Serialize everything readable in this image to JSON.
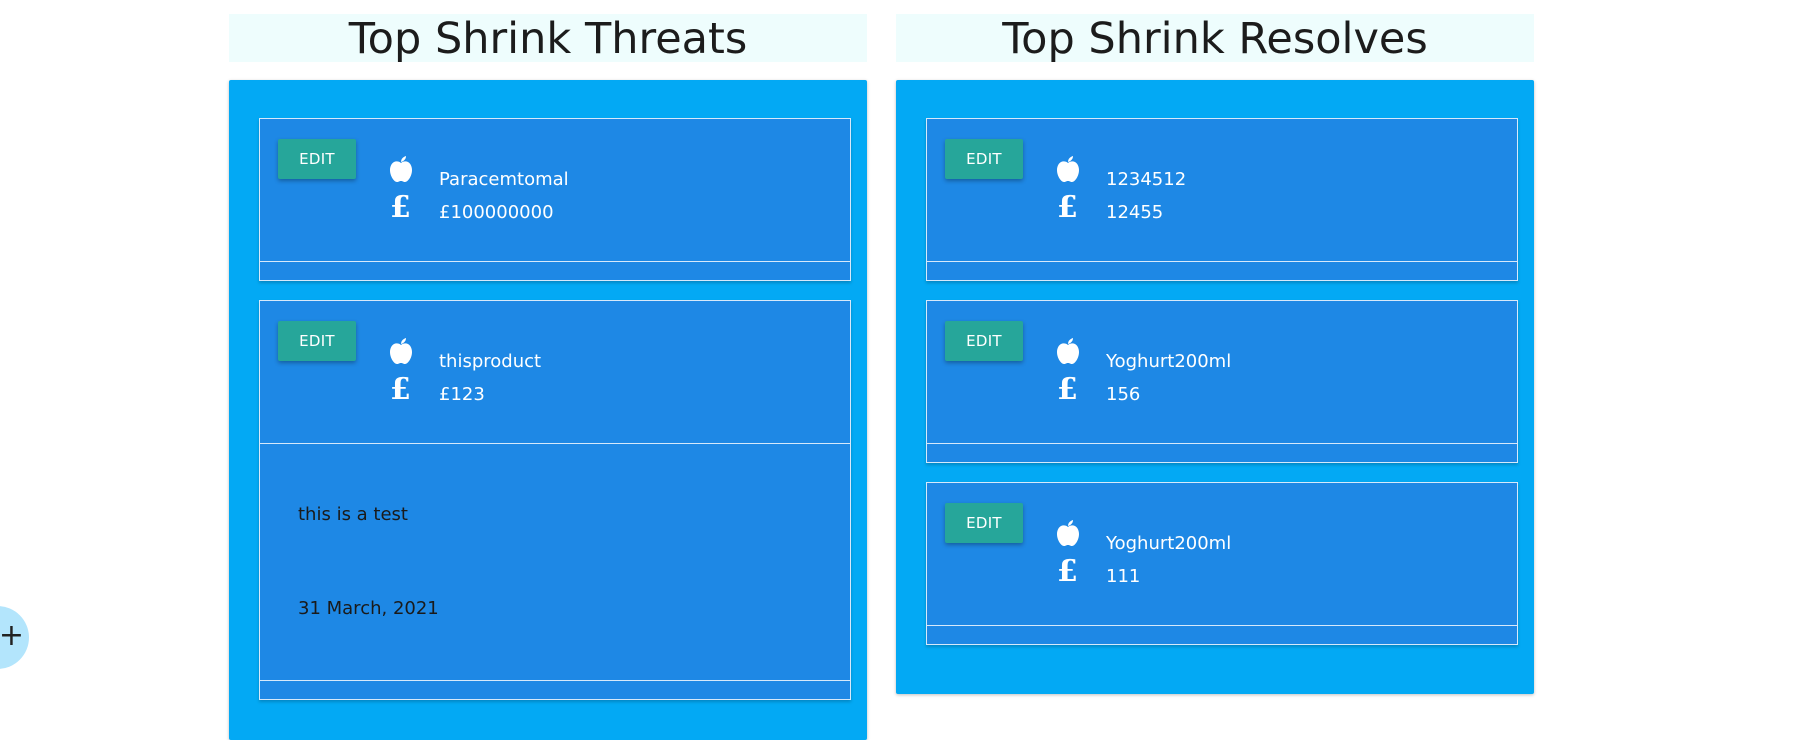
{
  "threats": {
    "title": "Top Shrink Threats",
    "cards": [
      {
        "edit_label": "EDIT",
        "product": "Paracemtomal",
        "value": "£100000000"
      },
      {
        "edit_label": "EDIT",
        "product": "thisproduct",
        "value": "£123",
        "note": "this is a test",
        "date": "31 March, 2021"
      }
    ]
  },
  "resolves": {
    "title": "Top Shrink Resolves",
    "cards": [
      {
        "edit_label": "EDIT",
        "product": "1234512",
        "value": "12455"
      },
      {
        "edit_label": "EDIT",
        "product": "Yoghurt200ml",
        "value": "156"
      },
      {
        "edit_label": "EDIT",
        "product": "Yoghurt200ml",
        "value": "111"
      }
    ]
  },
  "fab": {
    "label": "+"
  },
  "icons": {
    "product": "apple-icon",
    "price": "pound-sign-icon"
  },
  "colors": {
    "panel": "#03a9f4",
    "card": "#1e88e5",
    "button": "#26a69a",
    "title_bg": "#eefdfd"
  }
}
